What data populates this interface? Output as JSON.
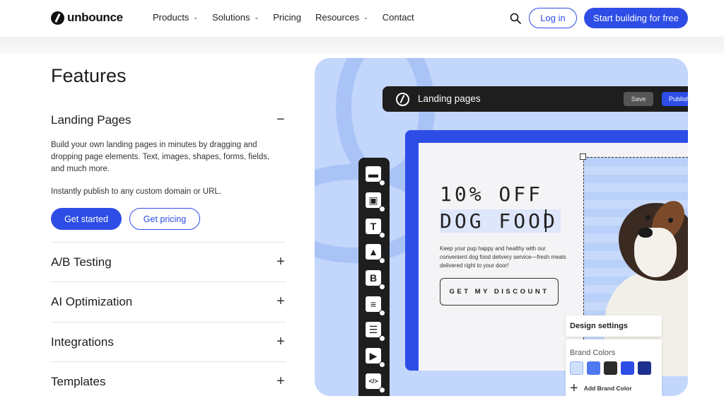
{
  "nav": {
    "logo_text": "unbounce",
    "items": [
      {
        "label": "Products",
        "has_dropdown": true
      },
      {
        "label": "Solutions",
        "has_dropdown": true
      },
      {
        "label": "Pricing",
        "has_dropdown": false
      },
      {
        "label": "Resources",
        "has_dropdown": true
      },
      {
        "label": "Contact",
        "has_dropdown": false
      }
    ],
    "chevron": "⌄",
    "login_label": "Log in",
    "start_label": "Start building for free"
  },
  "features": {
    "title": "Features",
    "accordion": [
      {
        "label": "Landing Pages",
        "state_symbol": "−",
        "expanded": true
      },
      {
        "label": "A/B Testing",
        "state_symbol": "+",
        "expanded": false
      },
      {
        "label": "AI Optimization",
        "state_symbol": "+",
        "expanded": false
      },
      {
        "label": "Integrations",
        "state_symbol": "+",
        "expanded": false
      },
      {
        "label": "Templates",
        "state_symbol": "+",
        "expanded": false
      }
    ],
    "description": "Build your own landing pages in minutes by dragging and dropping page elements. Text, images, shapes, forms, fields, and much more.",
    "description2": "Instantly publish to any custom domain or URL.",
    "get_started_label": "Get started",
    "get_pricing_label": "Get pricing"
  },
  "editor": {
    "title": "Landing pages",
    "save_label": "Save",
    "publish_label": "Publish",
    "headline1": "10% OFF",
    "headline2": "DOG FOOD",
    "copy": "Keep your pup happy and healthy with our convenient dog food delivery service—fresh meals delivered right to your door!",
    "cta_label": "GET MY DISCOUNT",
    "tools": [
      {
        "icon": "section-icon",
        "glyph": "▬"
      },
      {
        "icon": "box-icon",
        "glyph": "▣"
      },
      {
        "icon": "text-icon",
        "glyph": "T"
      },
      {
        "icon": "image-icon",
        "glyph": "▲"
      },
      {
        "icon": "button-icon",
        "glyph": "B"
      },
      {
        "icon": "form-icon",
        "glyph": "≡"
      },
      {
        "icon": "list-icon",
        "glyph": "☰"
      },
      {
        "icon": "video-icon",
        "glyph": "▶"
      },
      {
        "icon": "code-icon",
        "glyph": "</>"
      }
    ],
    "design_settings_label": "Design settings",
    "brand_colors_label": "Brand Colors",
    "brand_colors": [
      "#cfe0fd",
      "#4f79f0",
      "#2b2b2b",
      "#2e4de6",
      "#1d2f8f"
    ],
    "add_brand_color_label": "Add Brand Color",
    "add_symbol": "+"
  },
  "colors": {
    "accent": "#2e4de6",
    "hero_bg": "#c3d6fb"
  }
}
